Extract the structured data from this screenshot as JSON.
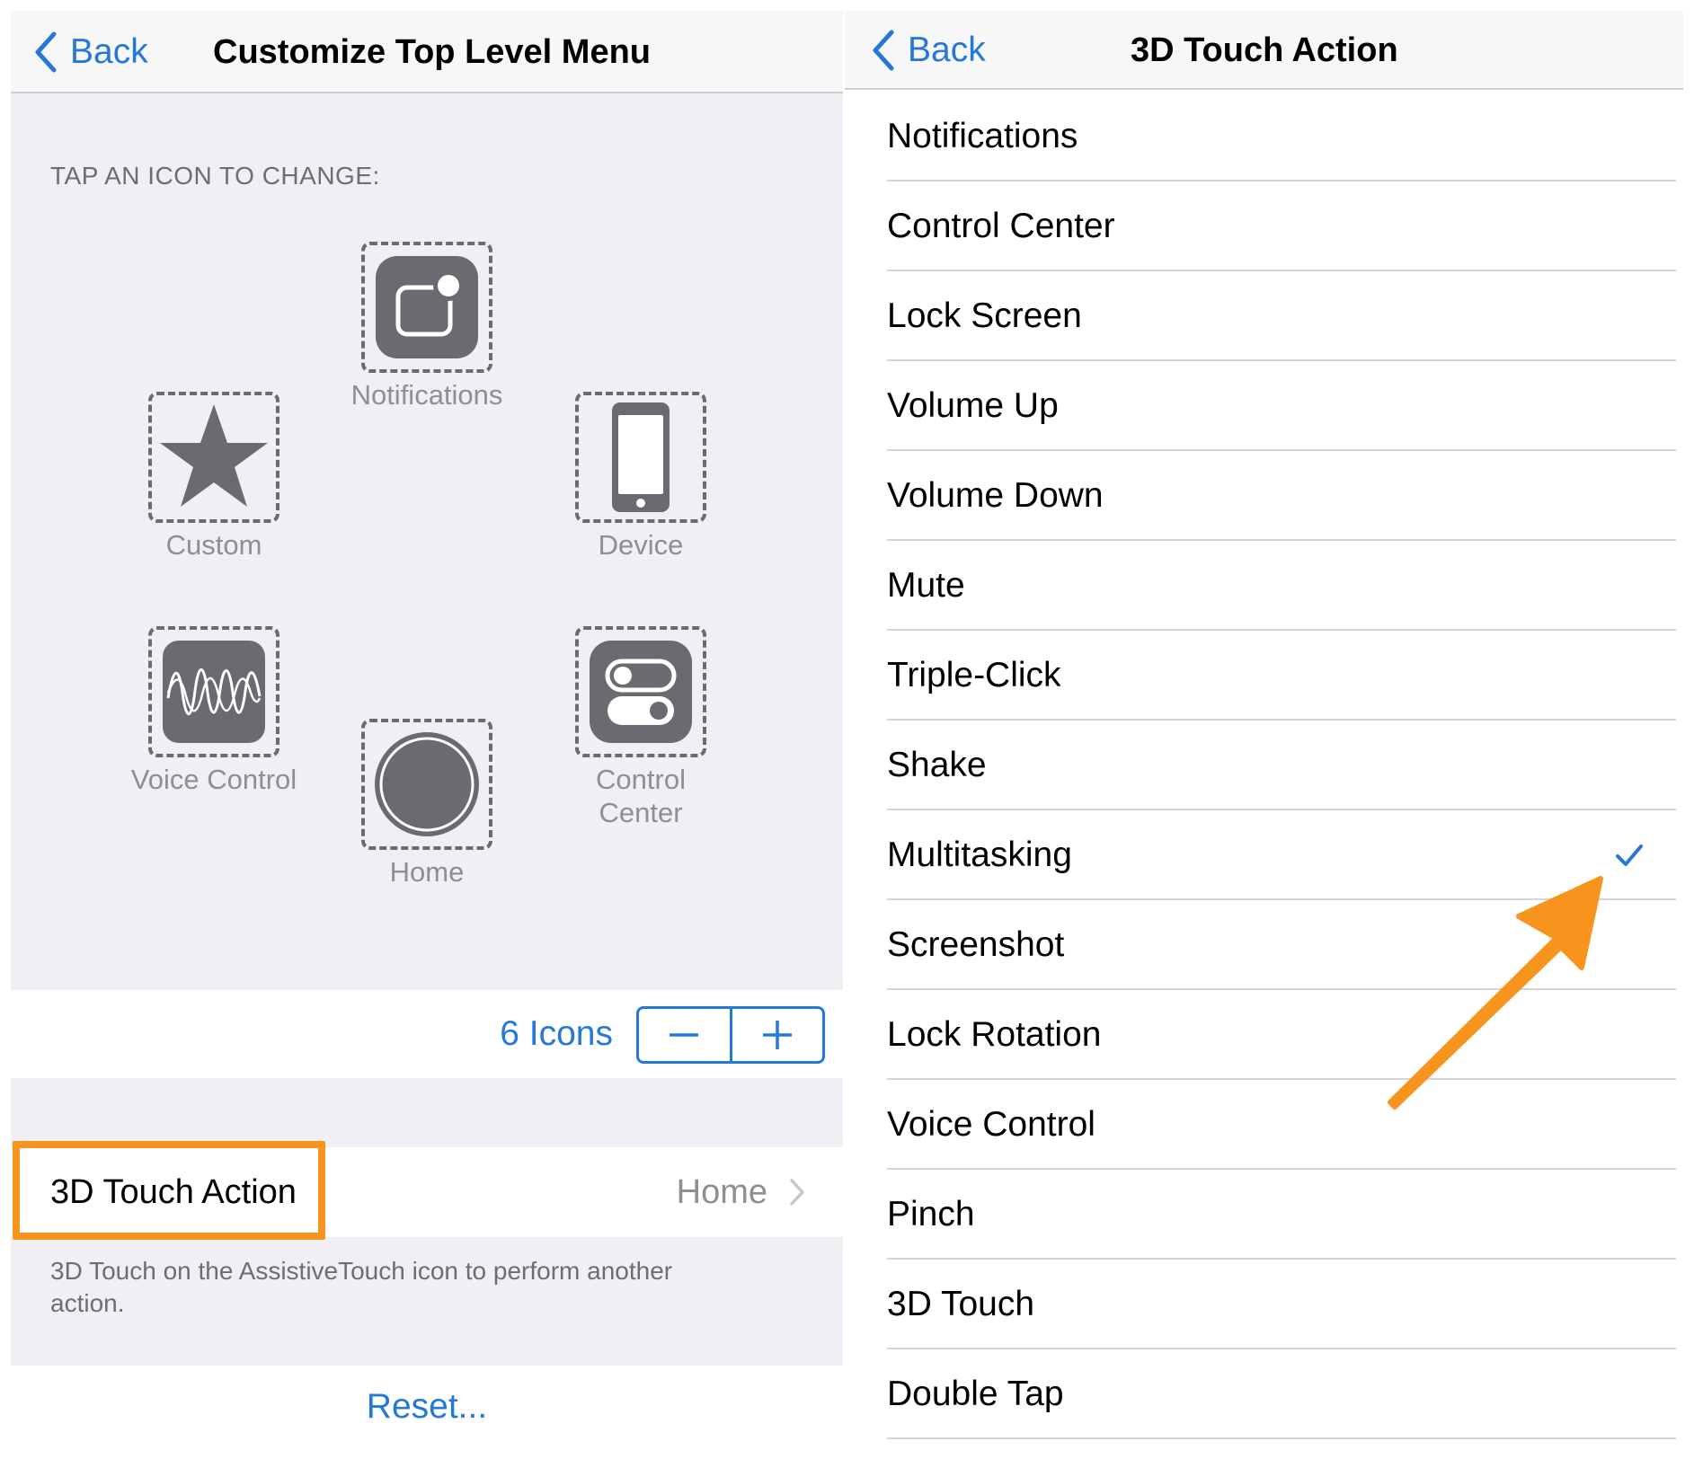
{
  "left_panel": {
    "back_label": "Back",
    "title": "Customize Top Level Menu",
    "section_header": "TAP AN ICON TO CHANGE:",
    "icons": {
      "notifications": "Notifications",
      "custom": "Custom",
      "device": "Device",
      "voice_control": "Voice Control",
      "home": "Home",
      "control_center": "Control\nCenter"
    },
    "icon_count_label": "6 Icons",
    "stepper": {
      "minus": "−",
      "plus": "+"
    },
    "touch_action_row": {
      "label": "3D Touch Action",
      "value": "Home"
    },
    "footer_note": "3D Touch on the AssistiveTouch icon to perform another action.",
    "reset_label": "Reset..."
  },
  "right_panel": {
    "back_label": "Back",
    "title": "3D Touch Action",
    "options": [
      {
        "label": "Notifications",
        "selected": false
      },
      {
        "label": "Control Center",
        "selected": false
      },
      {
        "label": "Lock Screen",
        "selected": false
      },
      {
        "label": "Volume Up",
        "selected": false
      },
      {
        "label": "Volume Down",
        "selected": false
      },
      {
        "label": "Mute",
        "selected": false
      },
      {
        "label": "Triple-Click",
        "selected": false
      },
      {
        "label": "Shake",
        "selected": false
      },
      {
        "label": "Multitasking",
        "selected": true
      },
      {
        "label": "Screenshot",
        "selected": false
      },
      {
        "label": "Lock Rotation",
        "selected": false
      },
      {
        "label": "Voice Control",
        "selected": false
      },
      {
        "label": "Pinch",
        "selected": false
      },
      {
        "label": "3D Touch",
        "selected": false
      },
      {
        "label": "Double Tap",
        "selected": false
      }
    ]
  },
  "colors": {
    "accent_blue": "#2479d8",
    "highlight_orange": "#f7941d",
    "icon_gray": "#6b6a70",
    "group_background": "#efeff4"
  }
}
